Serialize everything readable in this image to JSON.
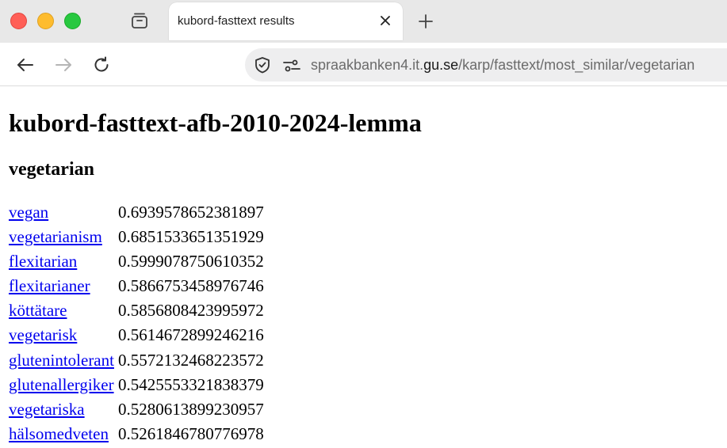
{
  "browser": {
    "tab": {
      "title": "kubord-fasttext results"
    },
    "address": {
      "subdomain": "spraakbanken4.it.",
      "domain": "gu.se",
      "path": "/karp/fasttext/most_similar/vegetarian"
    }
  },
  "page": {
    "title": "kubord-fasttext-afb-2010-2024-lemma",
    "query": "vegetarian",
    "results": [
      {
        "word": "vegan",
        "score": "0.6939578652381897"
      },
      {
        "word": "vegetarianism",
        "score": "0.6851533651351929"
      },
      {
        "word": "flexitarian",
        "score": "0.5999078750610352"
      },
      {
        "word": "flexitarianer",
        "score": "0.5866753458976746"
      },
      {
        "word": "köttätare",
        "score": "0.5856808423995972"
      },
      {
        "word": "vegetarisk",
        "score": "0.5614672899246216"
      },
      {
        "word": "glutenintolerant",
        "score": "0.5572132468223572"
      },
      {
        "word": "glutenallergiker",
        "score": "0.5425553321838379"
      },
      {
        "word": "vegetariska",
        "score": "0.5280613899230957"
      },
      {
        "word": "hälsomedveten",
        "score": "0.5261846780776978"
      }
    ]
  },
  "icons": {
    "close": "close-icon",
    "new_tab": "plus-icon",
    "back": "back-arrow-icon",
    "forward": "forward-arrow-icon",
    "reload": "reload-icon",
    "shield": "shield-icon",
    "site_info": "site-info-icon",
    "tab_overview": "tab-overview-icon"
  },
  "colors": {
    "link": "#0000ee",
    "traffic_red": "#ff5f57",
    "traffic_yellow": "#febc2e",
    "traffic_green": "#28c840"
  }
}
